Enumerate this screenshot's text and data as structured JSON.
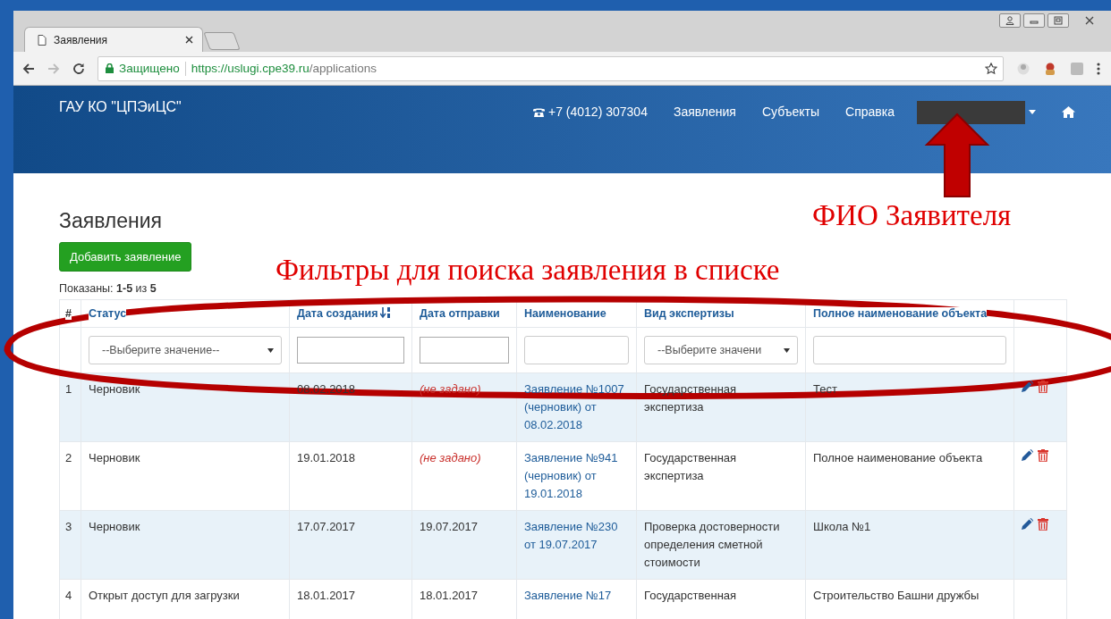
{
  "browser": {
    "tab": {
      "title": "Заявления",
      "selected": true
    },
    "secure_label": "Защищено",
    "url_host": "https://uslugi.cpe39.ru",
    "url_path": "/applications"
  },
  "navbar": {
    "brand": "ГАУ КО \"ЦПЭиЦС\"",
    "phone": "+7 (4012) 307304",
    "links": [
      "Заявления",
      "Субъекты",
      "Справка"
    ]
  },
  "page": {
    "title": "Заявления",
    "add_button": "Добавить заявление",
    "summary": "Показаны: **1-5** из **5**"
  },
  "table": {
    "columns": [
      {
        "label": "#",
        "kind": "plain",
        "sorted": false
      },
      {
        "label": "Статус",
        "kind": "link",
        "sorted": false
      },
      {
        "label": "Дата создания",
        "kind": "link",
        "sorted": true
      },
      {
        "label": "Дата отправки",
        "kind": "link",
        "sorted": false
      },
      {
        "label": "Наименование",
        "kind": "link",
        "sorted": false
      },
      {
        "label": "Вид экспертизы",
        "kind": "link",
        "sorted": false
      },
      {
        "label": "Полное наименование объекта",
        "kind": "link",
        "sorted": false
      }
    ],
    "filters": [
      {
        "kind": "none"
      },
      {
        "kind": "select",
        "placeholder": "--Выберите значение--"
      },
      {
        "kind": "text"
      },
      {
        "kind": "text"
      },
      {
        "kind": "text"
      },
      {
        "kind": "select",
        "placeholder": "--Выберите значени"
      },
      {
        "kind": "text"
      },
      {
        "kind": "none"
      }
    ],
    "rows": [
      {
        "num": "1",
        "status": "Черновик",
        "created": "08.02.2018",
        "sent": "(не задано)",
        "sent_set": false,
        "name": "Заявление №1007 (черновик) от 08.02.2018",
        "expertise": "Государственная экспертиза",
        "object": "Тест",
        "actions": true
      },
      {
        "num": "2",
        "status": "Черновик",
        "created": "19.01.2018",
        "sent": "(не задано)",
        "sent_set": false,
        "name": "Заявление №941 (черновик) от 19.01.2018",
        "expertise": "Государственная экспертиза",
        "object": "Полное наименование объекта",
        "actions": true
      },
      {
        "num": "3",
        "status": "Черновик",
        "created": "17.07.2017",
        "sent": "19.07.2017",
        "sent_set": true,
        "name": "Заявление №230 от 19.07.2017",
        "expertise": "Проверка достоверности определения сметной стоимости",
        "object": "Школа №1",
        "actions": true
      },
      {
        "num": "4",
        "status": "Открыт доступ для загрузки",
        "created": "18.01.2017",
        "sent": "18.01.2017",
        "sent_set": true,
        "name": "Заявление №17",
        "expertise": "Государственная",
        "object": "Строительство Башни дружбы",
        "actions": false
      }
    ]
  },
  "annotations": [
    {
      "kind": "arrow",
      "text": "ФИО Заявителя"
    },
    {
      "kind": "ellipse",
      "text": "Фильтры для поиска заявления в списке"
    }
  ]
}
